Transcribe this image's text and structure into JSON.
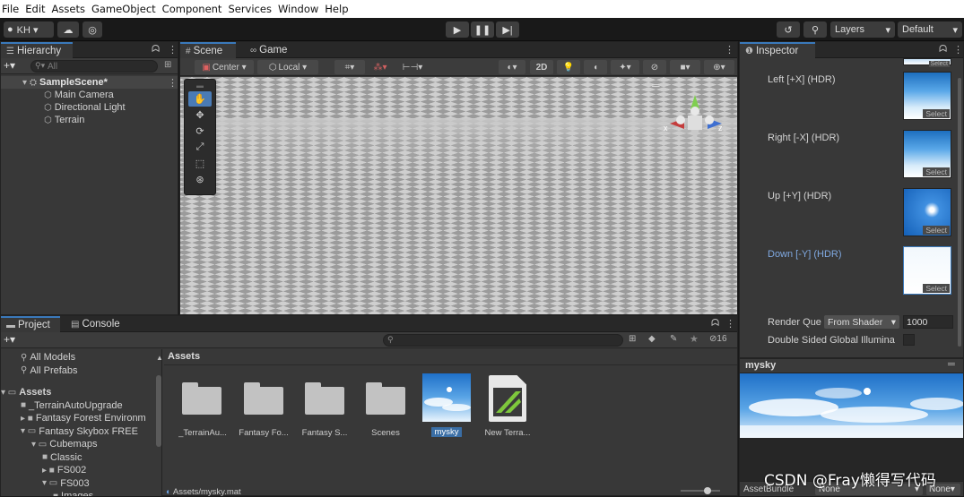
{
  "menu": [
    "File",
    "Edit",
    "Assets",
    "GameObject",
    "Component",
    "Services",
    "Window",
    "Help"
  ],
  "toolbar": {
    "account": "KH ▾",
    "layers": "Layers",
    "layout": "Default"
  },
  "hierarchy": {
    "tab": "Hierarchy",
    "search_placeholder": "All",
    "scene": "SampleScene*",
    "items": [
      "Main Camera",
      "Directional Light",
      "Terrain"
    ]
  },
  "scene": {
    "tab_scene": "Scene",
    "tab_game": "Game",
    "pivot": "Center",
    "space": "Local",
    "mode_2d": "2D",
    "axis_x": "x",
    "axis_z": "z"
  },
  "inspector": {
    "tab": "Inspector",
    "faces": [
      {
        "label": "Left [+X]  (HDR)",
        "select": "Select"
      },
      {
        "label": "Right [-X]  (HDR)",
        "select": "Select"
      },
      {
        "label": "Up [+Y]  (HDR)",
        "select": "Select"
      },
      {
        "label": "Down [-Y]  (HDR)",
        "select": "Select"
      }
    ],
    "top_select": "Select",
    "render_queue_label": "Render Que",
    "render_queue_mode": "From Shader",
    "render_queue_value": "1000",
    "double_sided": "Double Sided Global Illumina",
    "preview_name": "mysky",
    "asset_bundle_label": "AssetBundle",
    "asset_bundle_value": "None",
    "asset_bundle_variant": "None"
  },
  "project": {
    "tab_project": "Project",
    "tab_console": "Console",
    "hidden_count": "16",
    "tree": [
      {
        "label": "All Models",
        "indent": 1,
        "kind": "search"
      },
      {
        "label": "All Prefabs",
        "indent": 1,
        "kind": "search"
      },
      {
        "label": "Assets",
        "indent": 0,
        "kind": "folder-open",
        "bold": true
      },
      {
        "label": "_TerrainAutoUpgrade",
        "indent": 1,
        "kind": "folder"
      },
      {
        "label": "Fantasy Forest Environm",
        "indent": 1,
        "kind": "folder"
      },
      {
        "label": "Fantasy Skybox FREE",
        "indent": 1,
        "kind": "folder-open"
      },
      {
        "label": "Cubemaps",
        "indent": 2,
        "kind": "folder-open"
      },
      {
        "label": "Classic",
        "indent": 3,
        "kind": "folder"
      },
      {
        "label": "FS002",
        "indent": 3,
        "kind": "folder"
      },
      {
        "label": "FS003",
        "indent": 3,
        "kind": "folder-open"
      },
      {
        "label": "Images",
        "indent": 4,
        "kind": "folder"
      }
    ],
    "breadcrumb": "Assets",
    "assets": [
      "_TerrainAu...",
      "Fantasy Fo...",
      "Fantasy S...",
      "Scenes",
      "mysky",
      "New Terra..."
    ],
    "status_path": "Assets/mysky.mat"
  },
  "watermark": "CSDN @Fray懒得写代码"
}
